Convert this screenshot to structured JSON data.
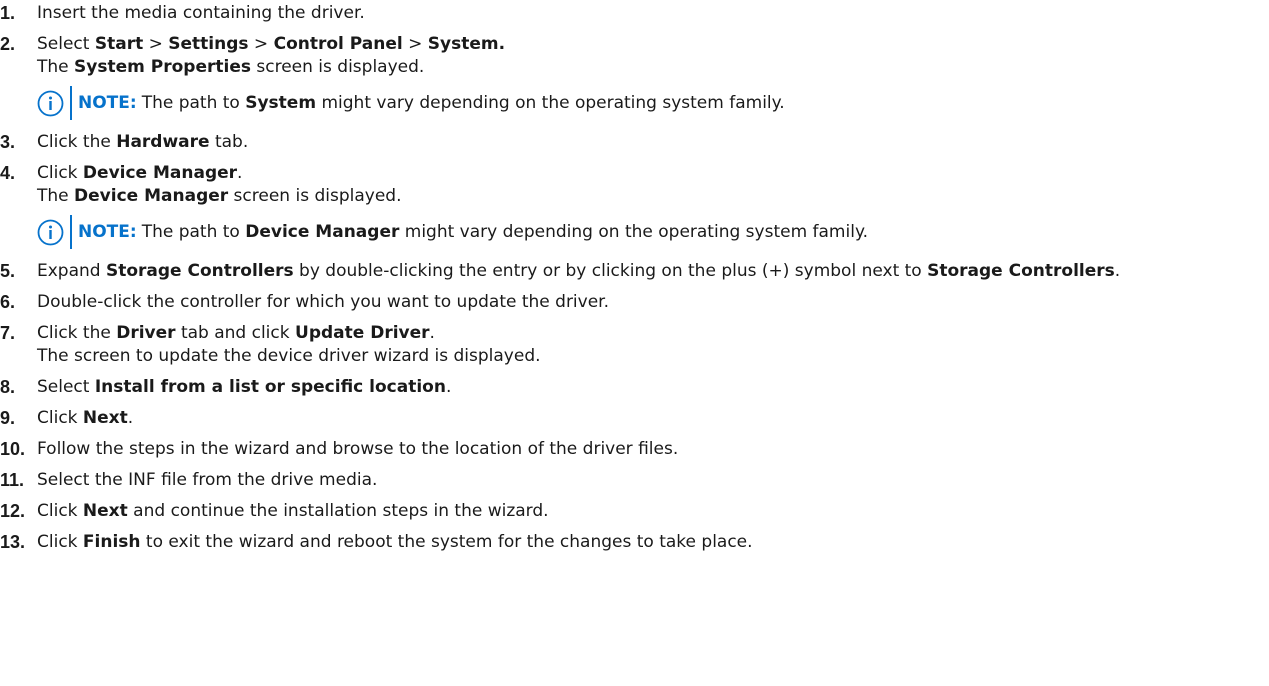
{
  "steps": [
    {
      "num": "1.",
      "parts": [
        {
          "t": "Insert the media containing the driver."
        }
      ]
    },
    {
      "num": "2.",
      "parts": [
        {
          "t": "Select "
        },
        {
          "t": "Start",
          "b": true
        },
        {
          "t": " > "
        },
        {
          "t": "Settings",
          "b": true
        },
        {
          "t": " > "
        },
        {
          "t": "Control Panel",
          "b": true
        },
        {
          "t": " > "
        },
        {
          "t": "System.",
          "b": true
        }
      ],
      "sub": [
        {
          "t": "The "
        },
        {
          "t": "System Properties",
          "b": true
        },
        {
          "t": " screen is displayed."
        }
      ],
      "note": {
        "label": "NOTE:",
        "parts": [
          {
            "t": "The path to "
          },
          {
            "t": "System",
            "b": true
          },
          {
            "t": " might vary depending on the operating system family."
          }
        ]
      }
    },
    {
      "num": "3.",
      "parts": [
        {
          "t": "Click the "
        },
        {
          "t": "Hardware",
          "b": true
        },
        {
          "t": " tab."
        }
      ]
    },
    {
      "num": "4.",
      "parts": [
        {
          "t": "Click "
        },
        {
          "t": "Device Manager",
          "b": true
        },
        {
          "t": "."
        }
      ],
      "sub": [
        {
          "t": "The "
        },
        {
          "t": "Device Manager",
          "b": true
        },
        {
          "t": " screen is displayed."
        }
      ],
      "note": {
        "label": "NOTE:",
        "parts": [
          {
            "t": "The path to "
          },
          {
            "t": "Device Manager",
            "b": true
          },
          {
            "t": " might vary depending on the operating system family."
          }
        ]
      }
    },
    {
      "num": "5.",
      "parts": [
        {
          "t": "Expand "
        },
        {
          "t": "Storage Controllers",
          "b": true
        },
        {
          "t": " by double-clicking the entry or by clicking on the plus (+) symbol next to "
        },
        {
          "t": "Storage Controllers",
          "b": true
        },
        {
          "t": "."
        }
      ]
    },
    {
      "num": "6.",
      "parts": [
        {
          "t": "Double-click the controller for which you want to update the driver."
        }
      ]
    },
    {
      "num": "7.",
      "parts": [
        {
          "t": "Click the "
        },
        {
          "t": "Driver",
          "b": true
        },
        {
          "t": " tab and click "
        },
        {
          "t": "Update Driver",
          "b": true
        },
        {
          "t": "."
        }
      ],
      "sub": [
        {
          "t": "The screen to update the device driver wizard is displayed."
        }
      ]
    },
    {
      "num": "8.",
      "parts": [
        {
          "t": "Select "
        },
        {
          "t": "Install from a list or specific location",
          "b": true
        },
        {
          "t": "."
        }
      ]
    },
    {
      "num": "9.",
      "parts": [
        {
          "t": "Click "
        },
        {
          "t": "Next",
          "b": true
        },
        {
          "t": "."
        }
      ]
    },
    {
      "num": "10.",
      "parts": [
        {
          "t": "Follow the steps in the wizard and browse to the location of the driver files."
        }
      ]
    },
    {
      "num": "11.",
      "parts": [
        {
          "t": "Select the INF file from the drive media."
        }
      ]
    },
    {
      "num": "12.",
      "parts": [
        {
          "t": "Click "
        },
        {
          "t": "Next",
          "b": true
        },
        {
          "t": " and continue the installation steps in the wizard."
        }
      ]
    },
    {
      "num": "13.",
      "parts": [
        {
          "t": "Click "
        },
        {
          "t": "Finish",
          "b": true
        },
        {
          "t": " to exit the wizard and reboot the system for the changes to take place."
        }
      ]
    }
  ],
  "colors": {
    "accent": "#0672cb",
    "text": "#1a1a1a"
  },
  "note_icon": "info-circle-icon"
}
